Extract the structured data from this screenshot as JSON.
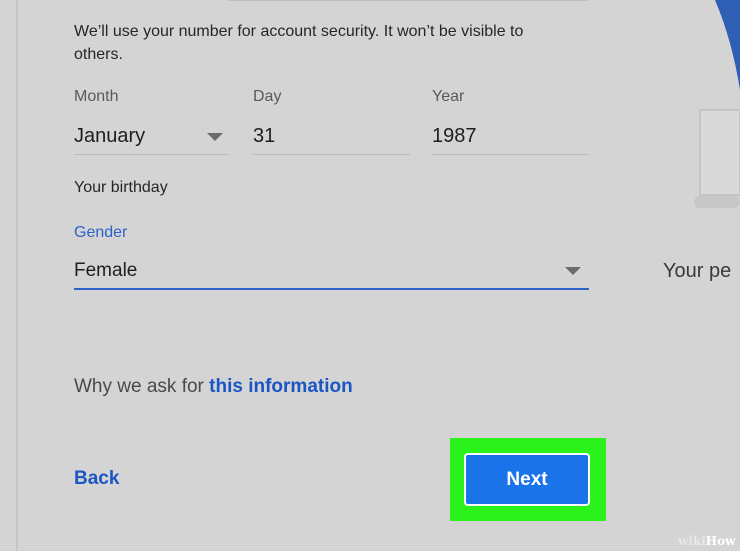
{
  "note": "We’ll use your number for account security. It won’t be visible to others.",
  "birth": {
    "month_label": "Month",
    "month_value": "January",
    "day_label": "Day",
    "day_value": "31",
    "year_label": "Year",
    "year_value": "1987",
    "caption": "Your birthday"
  },
  "gender": {
    "label": "Gender",
    "value": "Female"
  },
  "why": {
    "prefix": "Why we ask for ",
    "link": "this information"
  },
  "actions": {
    "back_label": "Back",
    "next_label": "Next"
  },
  "side": {
    "text": "Your pe"
  },
  "watermark": {
    "wiki": "wiki",
    "how": "How"
  },
  "colors": {
    "accent": "#1a73e8",
    "link": "#1a56c4",
    "highlight": "#2cf21c",
    "background": "#d4d4d4"
  }
}
